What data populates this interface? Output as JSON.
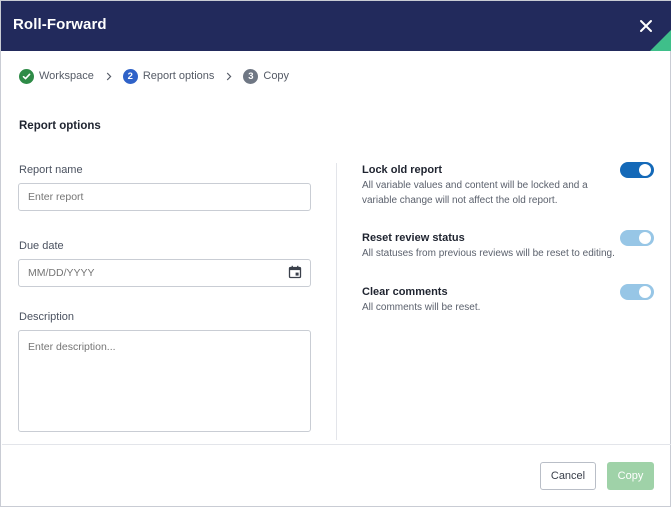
{
  "dialog": {
    "title": "Roll-Forward"
  },
  "stepper": {
    "steps": [
      {
        "number": "",
        "label": "Workspace",
        "state": "done"
      },
      {
        "number": "2",
        "label": "Report options",
        "state": "active"
      },
      {
        "number": "3",
        "label": "Copy",
        "state": "todo"
      }
    ]
  },
  "form": {
    "section_title": "Report options",
    "report_name": {
      "label": "Report name",
      "placeholder": "Enter report"
    },
    "due_date": {
      "label": "Due date",
      "placeholder": "MM/DD/YYYY"
    },
    "description": {
      "label": "Description",
      "placeholder": "Enter description..."
    }
  },
  "options": [
    {
      "title": "Lock old report",
      "description": "All variable values and content will be locked and a variable change will not affect the old report.",
      "state": "on"
    },
    {
      "title": "Reset review status",
      "description": "All statuses from previous reviews will be reset to editing.",
      "state": "on-disabled"
    },
    {
      "title": "Clear comments",
      "description": "All comments will be reset.",
      "state": "on-disabled"
    }
  ],
  "footer": {
    "cancel_label": "Cancel",
    "copy_label": "Copy"
  },
  "colors": {
    "header": "#222a5c",
    "accent_corner": "#3fbf8a",
    "toggle_on": "#1469b8",
    "toggle_disabled": "#97c6e6",
    "copy_disabled": "#9fd2a8",
    "step_done": "#2e8b47",
    "step_active": "#2f62c8"
  }
}
